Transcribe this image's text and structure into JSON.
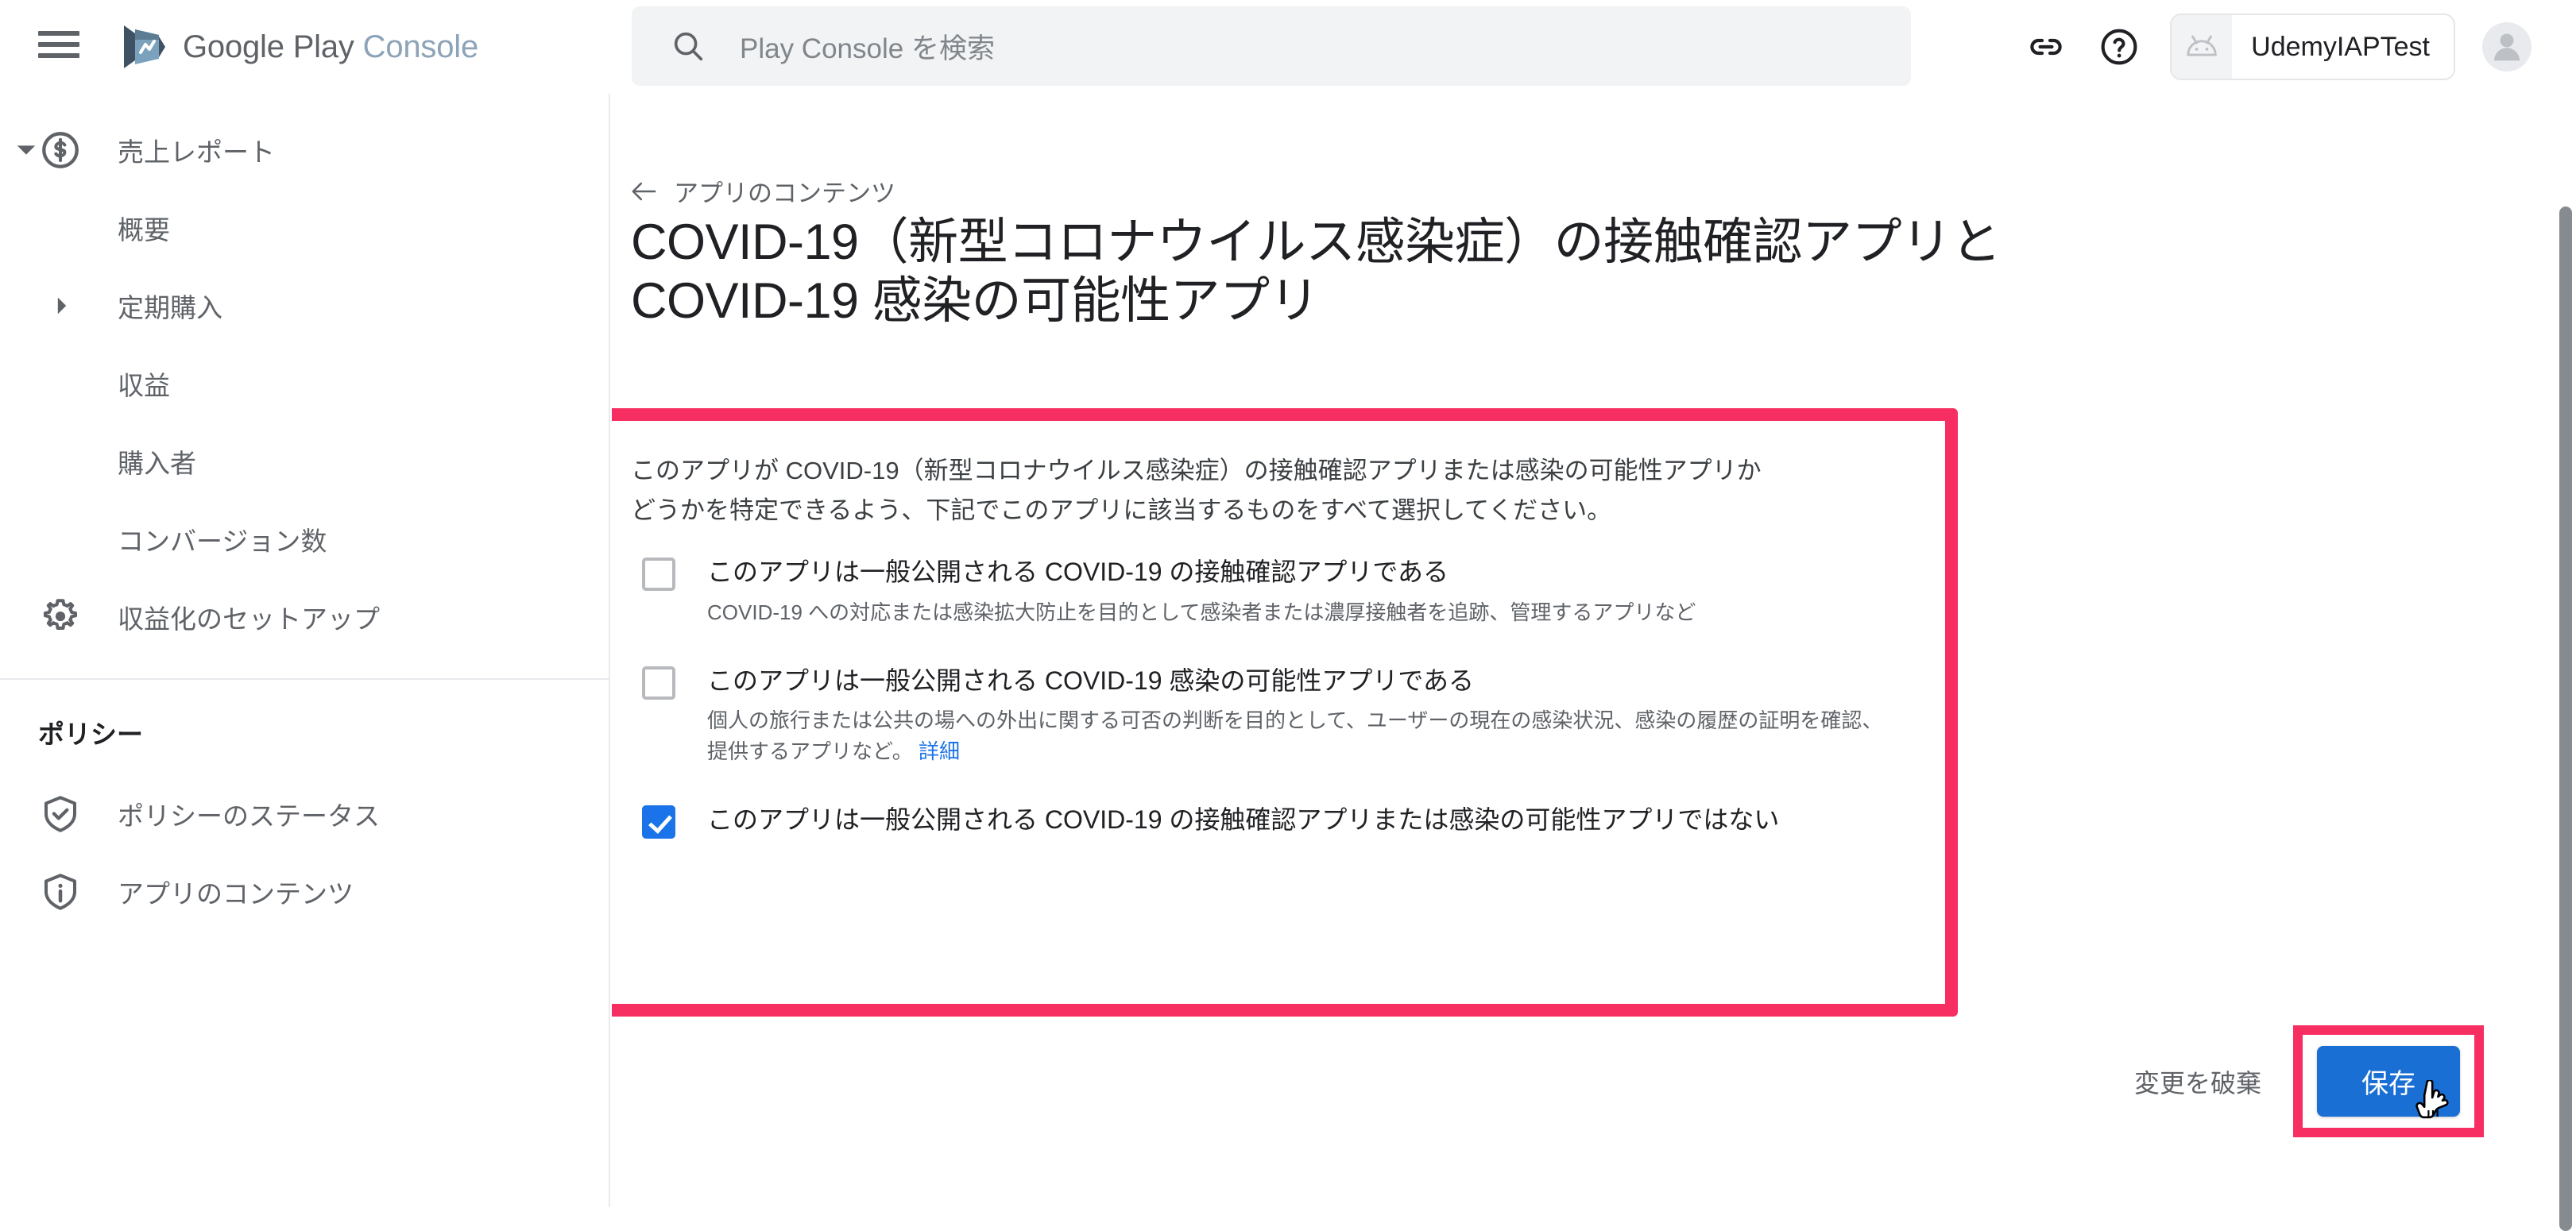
{
  "topbar": {
    "menu_label": "メニュー",
    "brand_primary": "Google Play",
    "brand_secondary": "Console",
    "search_placeholder": "Play Console を検索",
    "link_icon_label": "リンク",
    "help_icon_label": "ヘルプ",
    "app_chip_label": "UdemyIAPTest",
    "account_label": "アカウント"
  },
  "sidebar": {
    "group": {
      "label": "売上レポート",
      "items": [
        {
          "label": "概要",
          "has_arrow": false
        },
        {
          "label": "定期購入",
          "has_arrow": true
        },
        {
          "label": "収益",
          "has_arrow": false
        },
        {
          "label": "購入者",
          "has_arrow": false
        },
        {
          "label": "コンバージョン数",
          "has_arrow": false
        }
      ]
    },
    "monetization_label": "収益化のセットアップ",
    "section_title": "ポリシー",
    "policy_items": [
      {
        "label": "ポリシーのステータス",
        "icon": "shield-check-icon"
      },
      {
        "label": "アプリのコンテンツ",
        "icon": "info-shield-icon"
      }
    ]
  },
  "main": {
    "back_label": "アプリのコンテンツ",
    "title": "COVID-19（新型コロナウイルス感染症）の接触確認アプリと COVID-19 感染の可能性アプリ",
    "intro": "このアプリが COVID-19（新型コロナウイルス感染症）の接触確認アプリまたは感染の可能性アプリかどうかを特定できるよう、下記でこのアプリに該当するものをすべて選択してください。",
    "checkboxes": [
      {
        "label": "このアプリは一般公開される COVID-19 の接触確認アプリである",
        "description": "COVID-19 への対応または感染拡大防止を目的として感染者または濃厚接触者を追跡、管理するアプリなど",
        "checked": false,
        "link_text": ""
      },
      {
        "label": "このアプリは一般公開される COVID-19 感染の可能性アプリである",
        "description": "個人の旅行または公共の場への外出に関する可否の判断を目的として、ユーザーの現在の感染状況、感染の履歴の証明を確認、提供するアプリなど。",
        "checked": false,
        "link_text": "詳細"
      },
      {
        "label": "このアプリは一般公開される COVID-19 の接触確認アプリまたは感染の可能性アプリではない",
        "description": "",
        "checked": true,
        "link_text": ""
      }
    ],
    "discard_label": "変更を破棄",
    "save_label": "保存"
  },
  "colors": {
    "highlight": "#f72e62",
    "primary_blue": "#1a73e8",
    "save_blue": "#1a6fd4",
    "link_blue": "#1a73e8",
    "text_primary": "#202124",
    "text_secondary": "#5f6368"
  }
}
